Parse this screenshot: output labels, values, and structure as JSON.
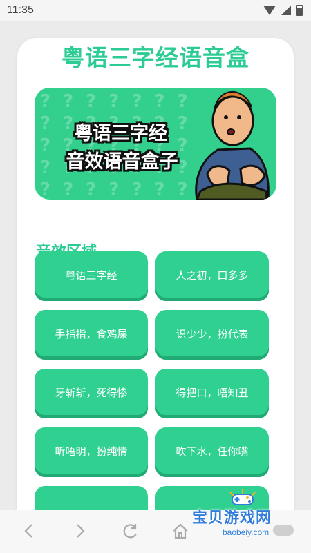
{
  "status_bar": {
    "time": "11:35"
  },
  "app": {
    "title": "粤语三字经语音盒",
    "accent_color": "#2dcc94"
  },
  "banner": {
    "line1": "粤语三字经",
    "line2": "音效语音盒子",
    "character_icon": "cartoon-boy-icon"
  },
  "sounds": {
    "section_title": "音效区域",
    "buttons": [
      "粤语三字经",
      "人之初，口多多",
      "手指指，食鸡屎",
      "识少少，扮代表",
      "牙斩斩，死得惨",
      "得把口，唔知丑",
      "听唔明，扮纯情",
      "吹下水，任你嘴"
    ]
  },
  "navigation": {
    "back_icon": "chevron-left-icon",
    "forward_icon": "chevron-right-icon",
    "refresh_icon": "refresh-icon",
    "home_icon": "home-icon"
  },
  "watermark": {
    "text": "宝贝游戏网",
    "url": "baobeiy.com"
  }
}
